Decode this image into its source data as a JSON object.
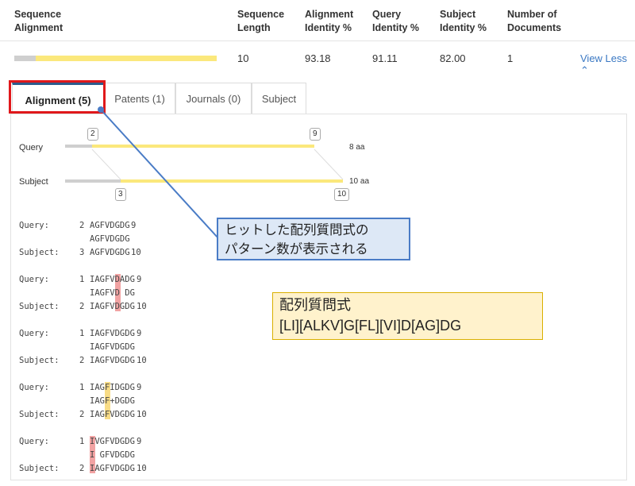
{
  "columns": {
    "seq_alignment": "Sequence\nAlignment",
    "seq_length": "Sequence\nLength",
    "align_identity": "Alignment\nIdentity %",
    "query_identity": "Query\nIdentity %",
    "subject_identity": "Subject\nIdentity %",
    "num_documents": "Number of\nDocuments"
  },
  "row": {
    "seq_length": "10",
    "align_identity": "93.18",
    "query_identity": "91.11",
    "subject_identity": "82.00",
    "num_documents": "1",
    "view_less": "View Less ⌃"
  },
  "tabs": [
    {
      "label": "Alignment (5)",
      "active": true
    },
    {
      "label": "Patents (1)",
      "active": false
    },
    {
      "label": "Journals (0)",
      "active": false
    },
    {
      "label": "Subject",
      "active": false
    }
  ],
  "diagram": {
    "query_label": "Query",
    "subject_label": "Subject",
    "query_start": "2",
    "query_end": "9",
    "query_len": "8 aa",
    "subject_start": "3",
    "subject_end": "10",
    "subject_len": "10 aa"
  },
  "alignments": [
    {
      "q_label": "Query:",
      "q_start": "2",
      "q_seq": "AGFVDGDG",
      "q_end": "9",
      "mid": "AGFVDGDG",
      "s_label": "Subject:",
      "s_start": "3",
      "s_seq": "AGFVDGDG",
      "s_end": "10"
    },
    {
      "q_label": "Query:",
      "q_start": "1",
      "q_seq": "IAGFVDADG",
      "q_end": "9",
      "mid": "IAGFVD DG",
      "s_label": "Subject:",
      "s_start": "2",
      "s_seq": "IAGFVDGDG",
      "s_end": "10"
    },
    {
      "q_label": "Query:",
      "q_start": "1",
      "q_seq": "IAGFVDGDG",
      "q_end": "9",
      "mid": "IAGFVDGDG",
      "s_label": "Subject:",
      "s_start": "2",
      "s_seq": "IAGFVDGDG",
      "s_end": "10"
    },
    {
      "q_label": "Query:",
      "q_start": "1",
      "q_seq": "IAGFIDGDG",
      "q_end": "9",
      "mid": "IAGF+DGDG",
      "s_label": "Subject:",
      "s_start": "2",
      "s_seq": "IAGFVDGDG",
      "s_end": "10"
    },
    {
      "q_label": "Query:",
      "q_start": "1",
      "q_seq": "IVGFVDGDG",
      "q_end": "9",
      "mid": "I GFVDGDG",
      "s_label": "Subject:",
      "s_start": "2",
      "s_seq": "IAGFVDGDG",
      "s_end": "10"
    }
  ],
  "callout_hits": "ヒットした配列質問式の\nパターン数が表示される",
  "callout_pattern": "配列質問式\n[LI][ALKV]G[FL][VI]D[AG]DG",
  "colors": {
    "accent": "#2d5b8c",
    "bar_yellow": "#fbe87c",
    "bar_gray": "#cfcfcf",
    "link": "#3a78c3",
    "highlight_red": "#e0181b",
    "callout_blue": "#4a7cc6"
  }
}
